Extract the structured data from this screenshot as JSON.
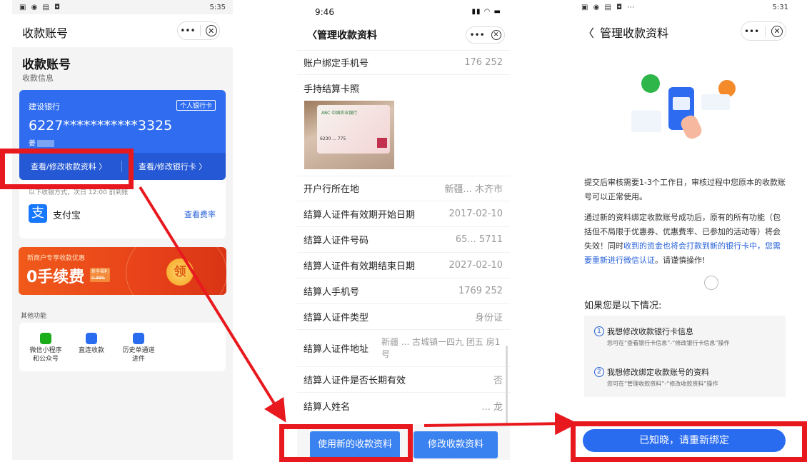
{
  "panel1": {
    "status_time": "5:35",
    "nav_title": "收款账号",
    "capsule_more": "•••",
    "capsule_close": "✕",
    "heading": "收款账号",
    "subheading": "收款信息",
    "bank_name": "建设银行",
    "bank_tag": "个人银行卡",
    "card_number": "6227***********3325",
    "holder_name": "姜",
    "btn_view_info": "查看/修改收款资料 〉",
    "btn_view_card": "查看/修改银行卡 〉",
    "notice": "以下收银方式，次日 12:00 前到账",
    "alipay_label": "支付宝",
    "alipay_rate": "查看费率",
    "banner_top": "新商户专享收款优惠",
    "banner_big": "0手续费",
    "banner_small_1": "新手福利",
    "banner_small_2": "0.38%",
    "banner_coin": "领",
    "other_title": "其他功能",
    "func_1": "微信小程序\n和公众号",
    "func_2": "直连收款",
    "func_3": "历史单通道\n进件"
  },
  "panel2": {
    "status_time": "9:46",
    "nav_title": "管理收款资料",
    "capsule_more": "•••",
    "capsule_close": "✕",
    "rows": [
      {
        "label": "账户绑定手机号",
        "value": "176 252"
      },
      {
        "label": "手持结算卡照",
        "value": ""
      },
      {
        "label": "开户行所在地",
        "value": "新疆... 木齐市"
      },
      {
        "label": "结算人证件有效期开始日期",
        "value": "2017-02-10"
      },
      {
        "label": "结算人证件号码",
        "value": "65... 5711"
      },
      {
        "label": "结算人证件有效期结束日期",
        "value": "2027-02-10"
      },
      {
        "label": "结算人手机号",
        "value": "1769 252"
      },
      {
        "label": "结算人证件类型",
        "value": "身份证"
      },
      {
        "label": "结算人证件地址",
        "value": "新疆 ... 古城镇一四九 团五 房1号"
      },
      {
        "label": "结算人证件是否长期有效",
        "value": "否"
      },
      {
        "label": "结算人姓名",
        "value": "... 龙"
      }
    ],
    "photo_card_text": "6230 ... 775",
    "btn_new": "使用新的收款资料",
    "btn_modify": "修改收款资料"
  },
  "panel3": {
    "status_time": "5:31",
    "nav_title": "管理收款资料",
    "capsule_more": "•••",
    "capsule_close": "✕",
    "para1": "提交后审核需要1-3个工作日，审核过程中您原本的收款账号可以正常使用。",
    "para2_a": "通过新的资料绑定收款账号成功后，原有的所有功能（包括但不局限于优惠券、优惠费率、已参加的活动等）将会失效！同时",
    "para2_b": "收到的资金也将会打款到新的银行卡中，您需要重新进行微信认证",
    "para2_c": "。请谨慎操作!",
    "case_title": "如果您是以下情况:",
    "case1_num": "1",
    "case1_title": "我想修改收款银行卡信息",
    "case1_desc": "您可在“查看银行卡信息”-“修改银行卡信息”操作",
    "case2_num": "2",
    "case2_title": "我想修改绑定收款账号的资料",
    "case2_desc": "您可在“管理收款资料”-“修改收款资料”操作",
    "confirm_btn": "已知晓，请重新绑定"
  },
  "colors": {
    "blue": "#2a6cf0",
    "red": "#e8191e",
    "link": "#2a63d8"
  }
}
